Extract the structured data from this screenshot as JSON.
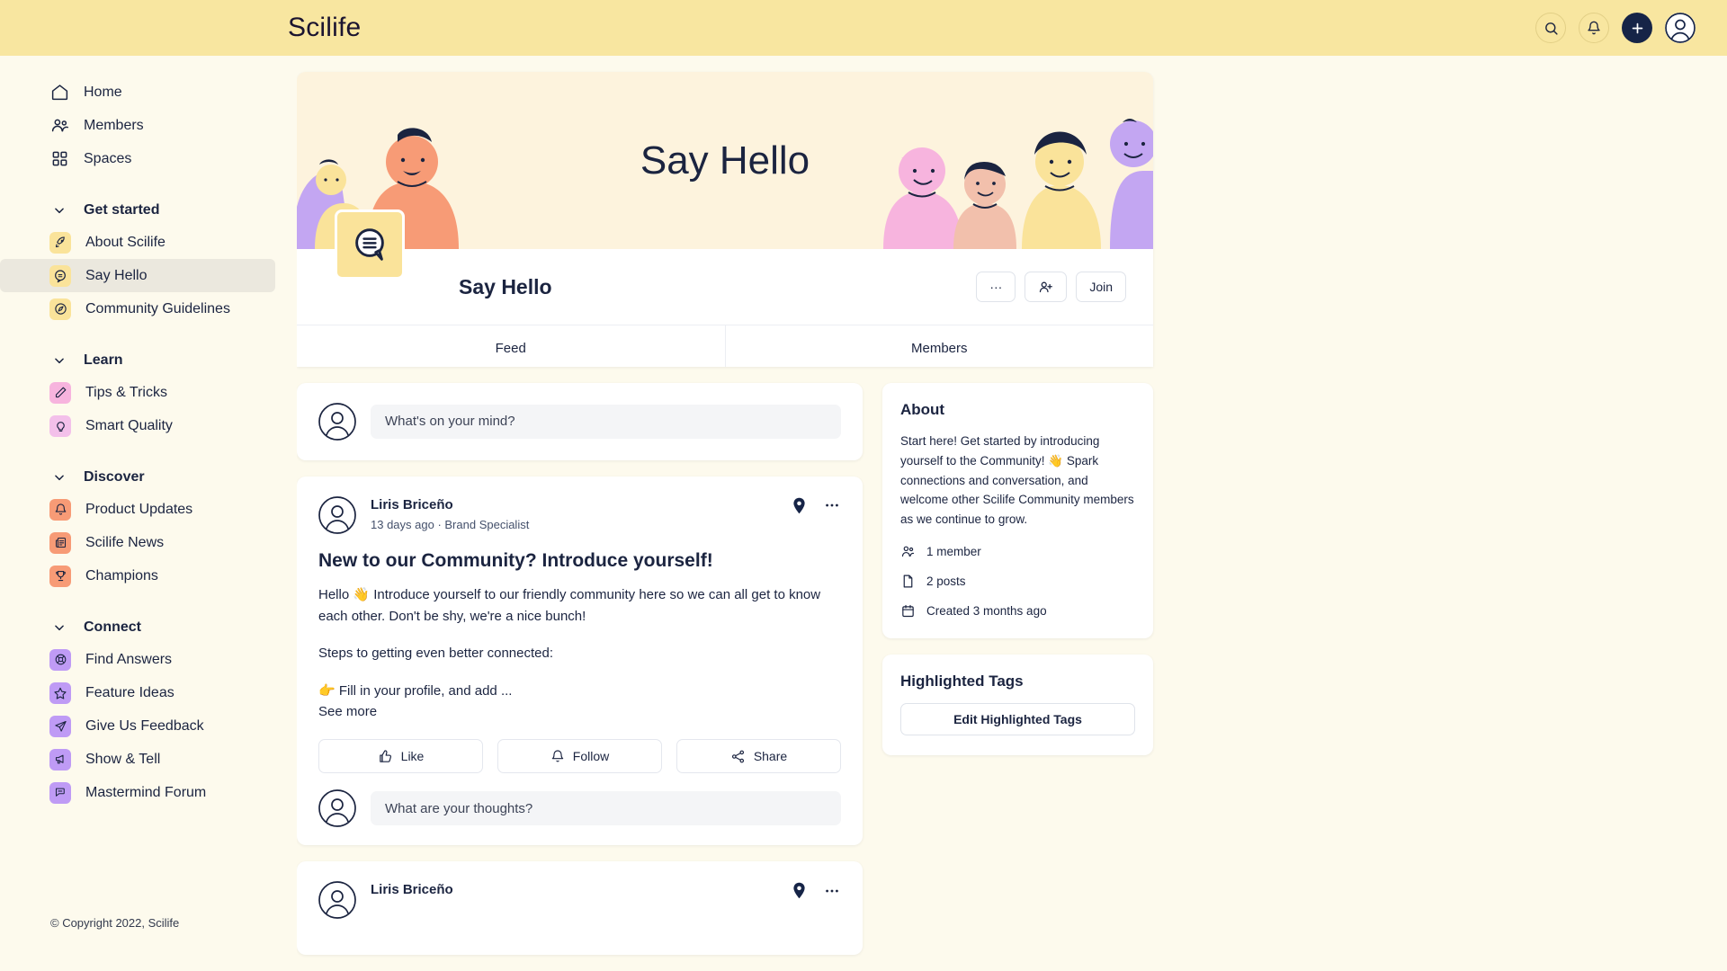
{
  "header": {
    "logo": "Scilife",
    "search_label": "search-icon",
    "notifications_label": "bell-icon",
    "create_label": "plus-icon",
    "account_label": "user-avatar"
  },
  "sidebar": {
    "top_items": [
      {
        "label": "Home",
        "icon": "home-icon"
      },
      {
        "label": "Members",
        "icon": "members-icon"
      },
      {
        "label": "Spaces",
        "icon": "spaces-icon"
      }
    ],
    "sections": [
      {
        "title": "Get started",
        "items": [
          {
            "label": "About Scilife",
            "icon": "rocket-icon",
            "color": "#fae39a"
          },
          {
            "label": "Say Hello",
            "icon": "chat-bubble-icon",
            "color": "#fae39a",
            "active": true
          },
          {
            "label": "Community Guidelines",
            "icon": "compass-icon",
            "color": "#fae39a"
          }
        ]
      },
      {
        "title": "Learn",
        "items": [
          {
            "label": "Tips & Tricks",
            "icon": "pencil-icon",
            "color": "#f7b4de"
          },
          {
            "label": "Smart Quality",
            "icon": "lightbulb-icon",
            "color": "#f3c0ea"
          }
        ]
      },
      {
        "title": "Discover",
        "items": [
          {
            "label": "Product Updates",
            "icon": "bell-icon",
            "color": "#f79b76"
          },
          {
            "label": "Scilife News",
            "icon": "news-icon",
            "color": "#f79b76"
          },
          {
            "label": "Champions",
            "icon": "trophy-icon",
            "color": "#f79b76"
          }
        ]
      },
      {
        "title": "Connect",
        "items": [
          {
            "label": "Find Answers",
            "icon": "lifebuoy-icon",
            "color": "#bf9bf5"
          },
          {
            "label": "Feature Ideas",
            "icon": "star-icon",
            "color": "#bf9bf5"
          },
          {
            "label": "Give Us Feedback",
            "icon": "send-icon",
            "color": "#bf9bf5"
          },
          {
            "label": "Show & Tell",
            "icon": "megaphone-icon",
            "color": "#bf9bf5"
          },
          {
            "label": "Mastermind Forum",
            "icon": "forum-icon",
            "color": "#bf9bf5"
          }
        ]
      }
    ],
    "copyright": "© Copyright 2022, Scilife"
  },
  "space": {
    "banner_title": "Say Hello",
    "title": "Say Hello",
    "more_label": "···",
    "invite_label": "invite-icon",
    "join_label": "Join",
    "tabs": [
      {
        "label": "Feed",
        "active": true
      },
      {
        "label": "Members",
        "active": false
      }
    ]
  },
  "composer": {
    "placeholder": "What's on your mind?"
  },
  "posts": [
    {
      "author": "Liris Briceño",
      "meta": "13 days ago · Brand Specialist",
      "title": "New to our Community? Introduce yourself!",
      "body": [
        "Hello 👋 Introduce yourself to our friendly community here so we can all get to know each other. Don't be shy, we're a nice bunch!",
        "Steps to getting even better connected:",
        "👉 Fill in your profile, and add ..."
      ],
      "see_more": "See more",
      "actions": [
        {
          "label": "Like",
          "icon": "thumbs-up-icon"
        },
        {
          "label": "Follow",
          "icon": "bell-icon"
        },
        {
          "label": "Share",
          "icon": "share-icon"
        }
      ],
      "comment_placeholder": "What are your thoughts?"
    },
    {
      "author": "Liris Briceño"
    }
  ],
  "about": {
    "title": "About",
    "description": "Start here! Get started by introducing yourself to the Community! 👋 Spark connections and conversation, and welcome other Scilife Community members as we continue to grow.",
    "stats": [
      {
        "label": "1 member",
        "icon": "members-icon"
      },
      {
        "label": "2 posts",
        "icon": "document-icon"
      },
      {
        "label": "Created 3 months ago",
        "icon": "calendar-icon"
      }
    ]
  },
  "highlighted_tags": {
    "title": "Highlighted Tags",
    "edit_label": "Edit Highlighted Tags"
  },
  "colors": {
    "header_bg": "#f8e6a0",
    "page_bg": "#fdfaed",
    "text": "#1b2440",
    "accent": "#162447",
    "banner_bg": "#fdf3dd"
  }
}
